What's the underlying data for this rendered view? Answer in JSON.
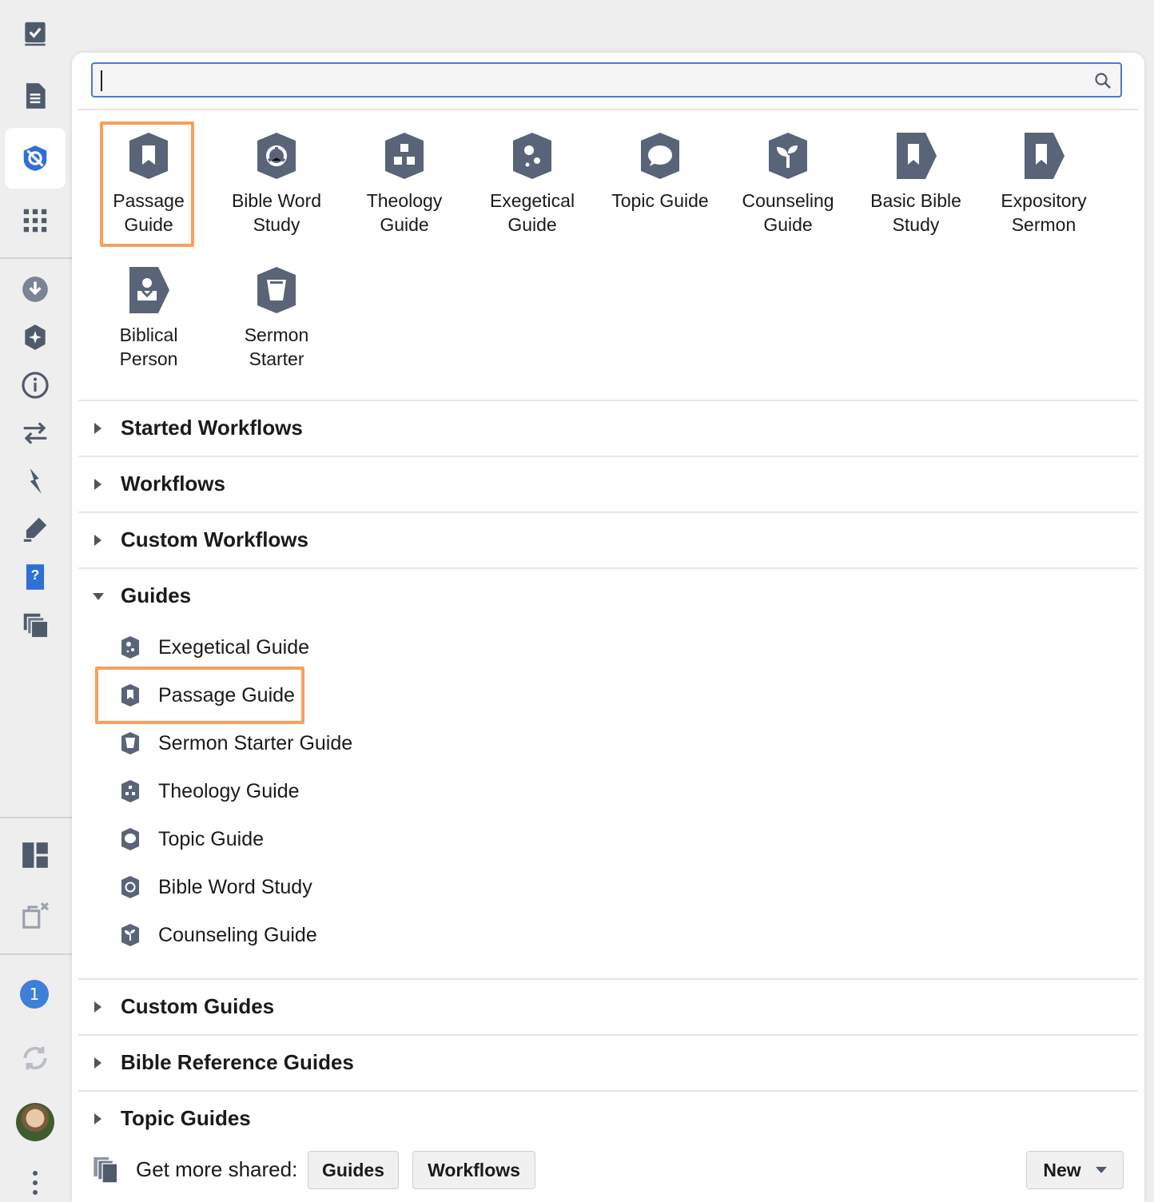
{
  "search": {
    "value": "",
    "placeholder": ""
  },
  "tiles": [
    {
      "label": "Passage\nGuide",
      "icon": "passage-guide-icon"
    },
    {
      "label": "Bible Word\nStudy",
      "icon": "bible-word-study-icon"
    },
    {
      "label": "Theology\nGuide",
      "icon": "theology-guide-icon"
    },
    {
      "label": "Exegetical\nGuide",
      "icon": "exegetical-guide-icon"
    },
    {
      "label": "Topic Guide",
      "icon": "topic-guide-icon"
    },
    {
      "label": "Counseling\nGuide",
      "icon": "counseling-guide-icon"
    },
    {
      "label": "Basic Bible\nStudy",
      "icon": "basic-bible-study-icon"
    },
    {
      "label": "Expository\nSermon",
      "icon": "expository-sermon-icon"
    },
    {
      "label": "Biblical\nPerson",
      "icon": "biblical-person-icon"
    },
    {
      "label": "Sermon\nStarter",
      "icon": "sermon-starter-icon"
    }
  ],
  "sections": {
    "started_workflows": "Started Workflows",
    "workflows": "Workflows",
    "custom_workflows": "Custom Workflows",
    "guides": "Guides",
    "custom_guides": "Custom Guides",
    "bible_reference_guides": "Bible Reference Guides",
    "topic_guides": "Topic Guides"
  },
  "guides": [
    "Exegetical Guide",
    "Passage Guide",
    "Sermon Starter Guide",
    "Theology Guide",
    "Topic Guide",
    "Bible Word Study",
    "Counseling Guide"
  ],
  "footer": {
    "label": "Get more shared:",
    "guides_button": "Guides",
    "workflows_button": "Workflows",
    "new_button": "New"
  },
  "rail": {
    "notification_count": "1"
  },
  "colors": {
    "icon": "#5a6478",
    "accent": "#3d6fd6",
    "highlight": "#f7a05f"
  }
}
